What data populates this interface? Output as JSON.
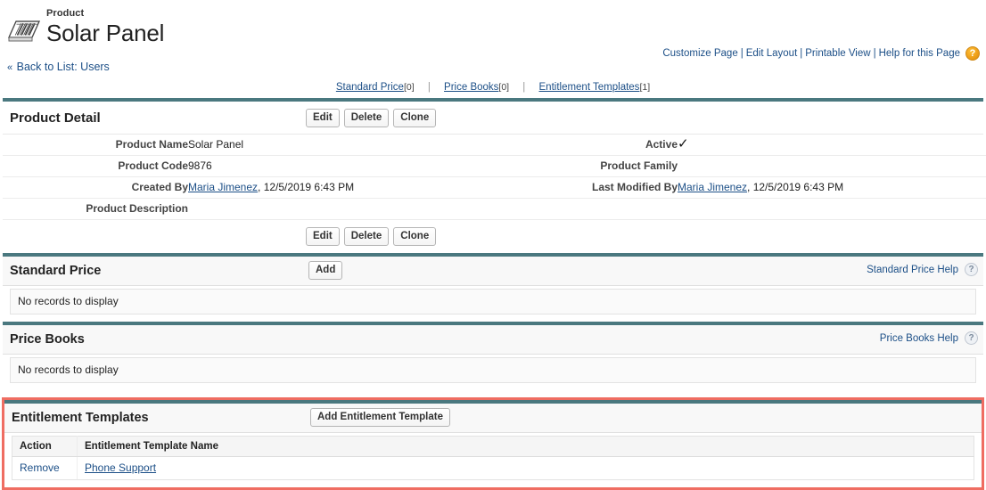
{
  "header": {
    "record_type": "Product",
    "record_name": "Solar Panel",
    "product_icon": "barcode-product-icon"
  },
  "top_links": {
    "customize_page": "Customize Page",
    "edit_layout": "Edit Layout",
    "printable_view": "Printable View",
    "help_for_this_page": "Help for this Page",
    "separator": "|",
    "help_icon": "question-mark-icon",
    "help_icon_glyph": "?",
    "help_icon_color": "#f0a019"
  },
  "back_link": {
    "chevron": "«",
    "label": "Back to List: Users"
  },
  "related_nav": {
    "separator": "|",
    "items": [
      {
        "label": "Standard Price",
        "count": "[0]"
      },
      {
        "label": "Price Books",
        "count": "[0]"
      },
      {
        "label": "Entitlement Templates",
        "count": "[1]"
      }
    ]
  },
  "detail": {
    "title": "Product Detail",
    "buttons": {
      "edit": "Edit",
      "delete": "Delete",
      "clone": "Clone"
    },
    "left_rows": [
      {
        "label": "Product Name",
        "value": "Solar Panel",
        "is_link": false
      },
      {
        "label": "Product Code",
        "value": "9876",
        "is_link": false
      },
      {
        "label": "Created By",
        "link_text": "Maria Jimenez",
        "value": ", 12/5/2019 6:43 PM",
        "is_link": true
      },
      {
        "label": "Product Description",
        "value": "",
        "is_link": false
      }
    ],
    "right_rows": [
      {
        "label": "Active",
        "value": "✓",
        "is_check": true
      },
      {
        "label": "Product Family",
        "value": "",
        "is_check": false
      },
      {
        "label": "Last Modified By",
        "link_text": "Maria Jimenez",
        "value": ", 12/5/2019 6:43 PM",
        "is_link": true
      }
    ]
  },
  "standard_price": {
    "title": "Standard Price",
    "add_button": "Add",
    "help_link": "Standard Price Help",
    "help_icon_glyph": "?",
    "empty_text": "No records to display"
  },
  "price_books": {
    "title": "Price Books",
    "help_link": "Price Books Help",
    "help_icon_glyph": "?",
    "empty_text": "No records to display"
  },
  "entitlement_templates": {
    "title": "Entitlement Templates",
    "add_button": "Add Entitlement Template",
    "columns": [
      "Action",
      "Entitlement Template Name"
    ],
    "rows": [
      {
        "action": "Remove",
        "name": "Phone Support"
      }
    ],
    "highlight_color": "#ef6d62"
  },
  "theme": {
    "section_bar_color": "#4a787f",
    "link_color": "#1c4f87"
  }
}
